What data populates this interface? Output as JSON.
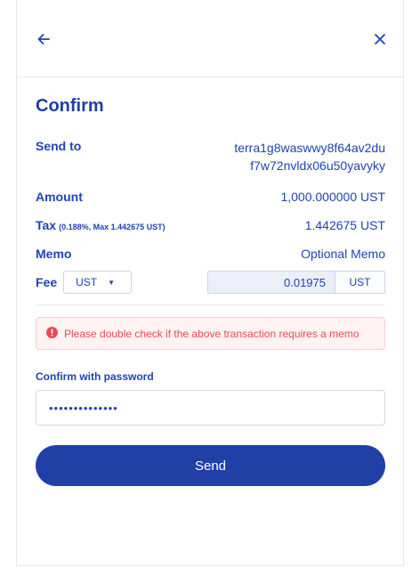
{
  "header": {
    "back_icon": "arrow-left-icon",
    "close_icon": "close-icon"
  },
  "title": "Confirm",
  "send_to": {
    "label": "Send to",
    "address_line1": "terra1g8waswwy8f64av2du",
    "address_line2": "f7w72nvldx06u50yavyky"
  },
  "amount": {
    "label": "Amount",
    "value": "1,000.000000 UST"
  },
  "tax": {
    "label": "Tax",
    "note": "(0.188%, Max 1.442675 UST)",
    "value": "1.442675 UST"
  },
  "memo": {
    "label": "Memo",
    "value": "Optional Memo"
  },
  "fee": {
    "label": "Fee",
    "denom_selected": "UST",
    "amount": "0.01975",
    "unit": "UST"
  },
  "alert": {
    "icon": "alert-circle-icon",
    "text": "Please double check if the above transaction requires a memo"
  },
  "password": {
    "label": "Confirm with password",
    "masked_value": "••••••••••••••"
  },
  "submit": {
    "label": "Send"
  },
  "colors": {
    "primary": "#2040a8",
    "text_blue": "#2043b5",
    "error": "#e64c57",
    "error_bg": "#fff2f3"
  }
}
